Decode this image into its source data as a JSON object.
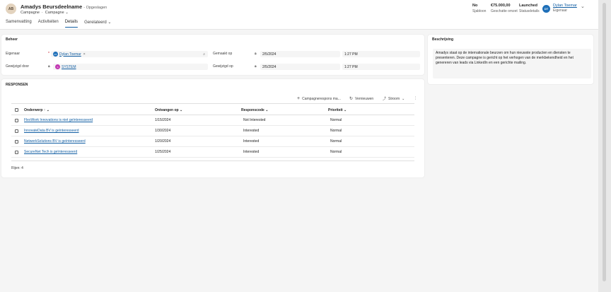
{
  "record": {
    "initials": "AB",
    "title": "Amadys Beursdeelname",
    "saved_status": "- Opgeslagen",
    "entity": "Campagne",
    "form_selector": "Campagne"
  },
  "header_fields": [
    {
      "value": "No",
      "label": "Sjabloon"
    },
    {
      "value": "€75.000,00",
      "label": "Geschatte omzet"
    },
    {
      "value": "Launched",
      "label": "Statusdetails"
    }
  ],
  "owner": {
    "initials": "DT",
    "name": "Dylan Toemar",
    "label": "Eigenaar"
  },
  "tabs": [
    {
      "label": "Samenvatting"
    },
    {
      "label": "Activiteiten"
    },
    {
      "label": "Details"
    },
    {
      "label": "Gerelateerd"
    }
  ],
  "beheer": {
    "title": "Beheer",
    "eigenaar_label": "Eigenaar",
    "eigenaar_initials": "DT",
    "eigenaar_value": "Dylan Toemar",
    "gewijzigd_door_label": "Gewijzigd door",
    "gewijzigd_door_initial": "S",
    "gewijzigd_door_value": "SYSTEM",
    "gemaakt_op_label": "Gemaakt op",
    "gemaakt_op_date": "2/5/2024",
    "gemaakt_op_time": "1:27 PM",
    "gewijzigd_op_label": "Gewijzigd op",
    "gewijzigd_op_date": "2/5/2024",
    "gewijzigd_op_time": "1:27 PM"
  },
  "beschrijving": {
    "title": "Beschrijving",
    "text": "Amadys staat op de internationale beurzen om hun nieuwste producten en diensten te presenteren. Deze campagne is gericht op het verhogen van de merkbekendheid en het genereren van leads via LinkedIn en een gerichte mailing."
  },
  "responses": {
    "title": "RESPONSEN",
    "toolbar": {
      "new_label": "Campagnerespons ma...",
      "refresh_label": "Vernieuwen",
      "flow_label": "Stroom"
    },
    "columns": [
      "Onderwerp ↑",
      "Ontvangen op",
      "Responscode",
      "Prioriteit"
    ],
    "rows": [
      {
        "subject": "FlexWork Innovations is niet geïnteresseerd",
        "date": "1/15/2024",
        "code": "Not Interested",
        "priority": "Normal"
      },
      {
        "subject": "InnovateData BV is geïnteresseerd",
        "date": "1/30/2024",
        "code": "Interested",
        "priority": "Normal"
      },
      {
        "subject": "NetwerkSolutions BV is geïnteresseerd",
        "date": "1/20/2024",
        "code": "Interested",
        "priority": "Normal"
      },
      {
        "subject": "SecureNet Tech is geïnteresseerd",
        "date": "1/25/2024",
        "code": "Interested",
        "priority": "Normal"
      }
    ],
    "rows_count": "Rijen: 4"
  },
  "colors": {
    "accent": "#115ea3",
    "owner_avatar": "#1e6fb8",
    "system_avatar": "#c239b3"
  }
}
